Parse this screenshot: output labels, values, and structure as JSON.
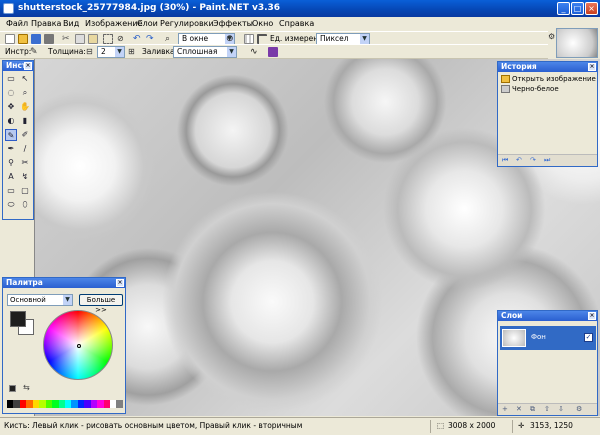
{
  "window": {
    "title": "shutterstock_25777984.jpg (30%) - Paint.NET v3.36",
    "minimize": "_",
    "maximize": "□",
    "close": "×"
  },
  "menu": [
    "Файл",
    "Правка",
    "Вид",
    "Изображение",
    "Слои",
    "Регулировки",
    "Эффекты",
    "Окно",
    "Справка"
  ],
  "toolbar1": {
    "zoom_label": "В окне",
    "units_label": "Ед. измерения:",
    "units_value": "Пиксел"
  },
  "toolbar2": {
    "tool_label": "Инстр:",
    "width_label": "Толщина:",
    "width_value": "2",
    "fill_label": "Заливка:",
    "fill_value": "Сплошная"
  },
  "tools_panel": {
    "title": "Инст",
    "tools": [
      "▭",
      "↖",
      "◌",
      "⌕",
      "✥",
      "✋",
      "◐",
      "▮",
      "✎",
      "✐",
      "✒",
      "∕",
      "⚲",
      "✂",
      "A",
      "↯",
      "▭",
      "▢",
      "⬭",
      "⬯"
    ]
  },
  "history_panel": {
    "title": "История",
    "items": [
      "Открыть изображение",
      "Черно-белое"
    ],
    "controls": [
      "⏮",
      "↶",
      "↷",
      "⏭"
    ]
  },
  "palette_panel": {
    "title": "Палитра",
    "mode": "Основной",
    "more_button": "Больше >>",
    "colors": [
      "#000000",
      "#404040",
      "#ff0000",
      "#ff6a00",
      "#ffd800",
      "#b6ff00",
      "#4cff00",
      "#00ff21",
      "#00ff90",
      "#00ffff",
      "#0094ff",
      "#0026ff",
      "#4800ff",
      "#b200ff",
      "#ff00dc",
      "#ff006e",
      "#ffffff",
      "#808080"
    ]
  },
  "layers_panel": {
    "title": "Слои",
    "layer_name": "Фон",
    "controls": [
      "+",
      "✕",
      "⧉",
      "⇧",
      "⇩",
      "⚙"
    ]
  },
  "status": {
    "hint": "Кисть: Левый клик - рисовать основным цветом, Правый клик - вторичным",
    "image_size": "3008 x 2000",
    "cursor_pos": "3153, 1250"
  }
}
